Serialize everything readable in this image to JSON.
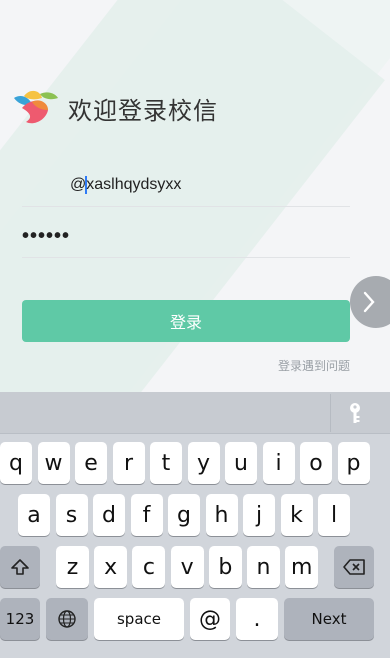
{
  "app": {
    "title": "欢迎登录校信"
  },
  "login": {
    "username_prefix": "@",
    "username_value": "xaslhqydsyxx",
    "password_mask": "••••••",
    "login_button": "登录",
    "help_link": "登录遇到问题"
  },
  "keyboard": {
    "row1": [
      "q",
      "w",
      "e",
      "r",
      "t",
      "y",
      "u",
      "i",
      "o",
      "p"
    ],
    "row2": [
      "a",
      "s",
      "d",
      "f",
      "g",
      "h",
      "j",
      "k",
      "l"
    ],
    "row3": [
      "z",
      "x",
      "c",
      "v",
      "b",
      "n",
      "m"
    ],
    "numbers_key": "123",
    "space_key": "space",
    "at_key": "@",
    "dot_key": ".",
    "next_key": "Next"
  },
  "colors": {
    "accent": "#5fc9a6",
    "stripe": "#e3efeb",
    "keyboard_bg": "#d1d5db"
  },
  "icons": [
    "app-logo-icon",
    "chevron-right-icon",
    "key-icon",
    "shift-icon",
    "backspace-icon",
    "globe-icon"
  ]
}
